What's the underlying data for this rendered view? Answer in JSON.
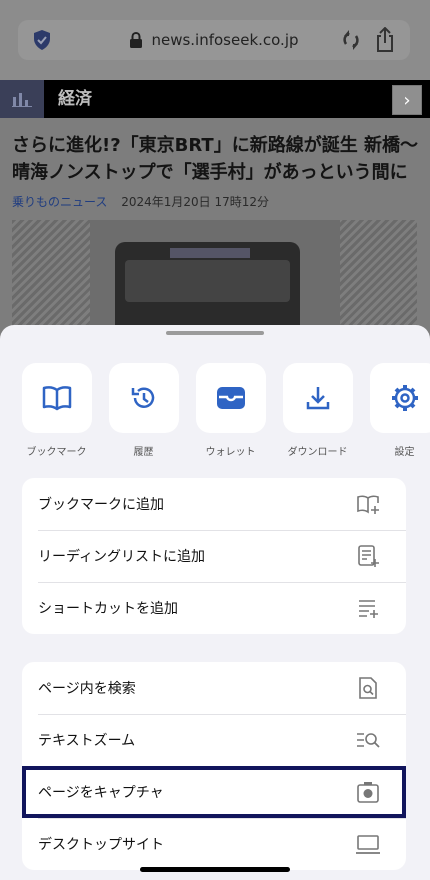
{
  "browser": {
    "url": "news.infoseek.co.jp"
  },
  "category": {
    "label": "経済"
  },
  "article": {
    "headline": "さらに進化!?「東京BRT」に新路線が誕生 新橋〜晴海ノンストップで「選手村」があっという間に",
    "source": "乗りものニュース",
    "date": "2024年1月20日 17時12分"
  },
  "tiles": [
    {
      "label": "ブックマーク",
      "icon": "book-icon"
    },
    {
      "label": "履歴",
      "icon": "history-icon"
    },
    {
      "label": "ウォレット",
      "icon": "wallet-icon"
    },
    {
      "label": "ダウンロード",
      "icon": "download-icon"
    },
    {
      "label": "設定",
      "icon": "gear-icon"
    }
  ],
  "menu_group1": [
    {
      "label": "ブックマークに追加",
      "icon": "add-bookmark-icon"
    },
    {
      "label": "リーディングリストに追加",
      "icon": "reading-list-icon"
    },
    {
      "label": "ショートカットを追加",
      "icon": "add-shortcut-icon"
    }
  ],
  "menu_group2": [
    {
      "label": "ページ内を検索",
      "icon": "find-in-page-icon"
    },
    {
      "label": "テキストズーム",
      "icon": "text-zoom-icon"
    },
    {
      "label": "ページをキャプチャ",
      "icon": "camera-icon"
    },
    {
      "label": "デスクトップサイト",
      "icon": "desktop-icon"
    }
  ],
  "colors": {
    "accent": "#2f64c4",
    "highlight_border": "#11155c",
    "sheet_background": "#f2f2f7"
  }
}
